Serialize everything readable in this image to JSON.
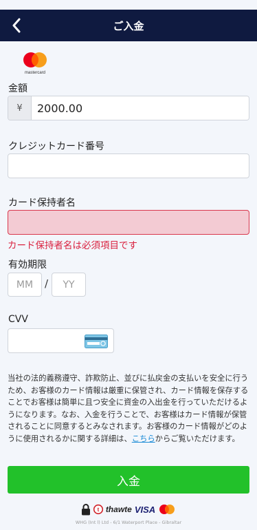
{
  "header": {
    "title": "ご入金"
  },
  "payment_method": {
    "logo_text": "mastercard"
  },
  "amount": {
    "label": "金額",
    "currency_symbol": "¥",
    "value": "2000.00"
  },
  "card_number": {
    "label": "クレジットカード番号",
    "value": ""
  },
  "card_holder": {
    "label": "カード保持者名",
    "value": "",
    "error": "カード保持者名は必須項目です"
  },
  "expiry": {
    "label": "有効期限",
    "month_placeholder": "MM",
    "separator": "/",
    "year_placeholder": "YY"
  },
  "cvv": {
    "label": "CVV",
    "value": ""
  },
  "notice": {
    "text": "当社の法的義務遵守、詐欺防止、並びに払戻金の支払いを安全に行うため、お客様のカード情報は厳重に保管され、カード情報を保存することでお客様は簡単に且つ安全に資金の入出金を行っていただけるようになります。なお、入金を行うことで、お客様はカード情報が保管されることに同意するとみなされます。お客様のカード情報がどのように使用されるかに関する詳細は、",
    "link": "こちら",
    "suffix": "からご覧いただけます。"
  },
  "submit": {
    "label": "入金"
  },
  "badges": {
    "thawte": "thawte",
    "visa": "VISA"
  },
  "footer": {
    "text": "WHG (Int l) Ltd - 6/1 Waterport Place - Gibraltar"
  },
  "colors": {
    "header_bg": "#0f1a40",
    "submit_bg": "#22c12a",
    "error": "#d9213f",
    "error_field_bg": "#f3cbd3",
    "link": "#1a8bd6"
  }
}
